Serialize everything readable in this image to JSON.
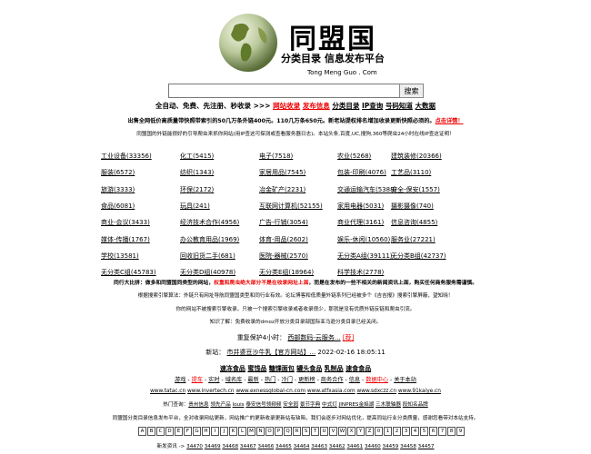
{
  "header": {
    "title": "同盟国",
    "subtitle": "分类目录  信息发布平台",
    "pinyin": "Tong Meng Guo . Com"
  },
  "search": {
    "value": "",
    "button": "搜索"
  },
  "nav": {
    "prefix": "全自动、免费、先注册、秒收录 >>>",
    "items": [
      {
        "label": "网站收录",
        "red": true
      },
      {
        "label": "发布信息",
        "red": true
      },
      {
        "label": "分类目录",
        "red": false
      },
      {
        "label": "IP查询",
        "red": false
      },
      {
        "label": "号码知道",
        "red": false
      },
      {
        "label": "大数据",
        "red": false
      }
    ]
  },
  "notice1": {
    "text": "出售全网低价高质量带快照带索引的50几万条外链400元。110几万条650元。新老站提权排名增加收录更新快照必须的。",
    "link": "点击详情！"
  },
  "notice2": "同盟国的外链能很好的引导爬虫来抓你网站(用IP查这可探测或查看服务器日志)。本站头条,百度,UC,搜狗,360等爬虫24小时在线IP查这证明！",
  "categories": [
    [
      "工业设备(33356)",
      "化工(5415)",
      "电子(7518)",
      "农业(5268)",
      "建筑装修(20366)"
    ],
    [
      "服装(6572)",
      "纺织(1343)",
      "家居用品(7545)",
      "包装-印刷(4076)",
      "工艺品(3110)"
    ],
    [
      "旅游(3333)",
      "环保(2172)",
      "冶金矿产(2231)",
      "交通运输汽车(5388)",
      "安全-保安(1557)"
    ],
    [
      "食品(6081)",
      "玩具(241)",
      "互联网计算机(52155)",
      "家用电器(5031)",
      "摄影摄像(740)"
    ],
    [
      "商业-会议(3433)",
      "经济技术合作(4956)",
      "广告-行销(3054)",
      "商业代理(3161)",
      "信息咨询(4855)"
    ],
    [
      "媒体-传播(1767)",
      "办公教育用品(1969)",
      "体育-用品(2602)",
      "娱乐-休闲(10560)",
      "服务业(27221)"
    ],
    [
      "学校(13581)",
      "回收旧货二手(681)",
      "医院-器械(2570)",
      "无分类A组(39111)",
      "无分类B组(42737)"
    ],
    [
      "无分类C组(45783)",
      "无分类D组(40978)",
      "无分类E组(18964)",
      "科学技术(2778)",
      ""
    ]
  ],
  "info": {
    "line1_a": "同行大比拼：做多和同盟国同类型的网站，",
    "line1_red": "权重和爬虫绝大部分不是在收录网址上面",
    "line1_b": "，而是在发布的一些不相关的新闻资讯上面，购买任何商务服务需谨慎。",
    "line2": "根据搜索引擎算法：外链只有网址导航同盟国类型和同行业有效。论坛博客和低质量外链系列已经被多个《吉吉报》搜索引擎屏蔽，望知晓！",
    "line3": "你的网站不被搜索引擎收录，只被一个搜索引擎收录或者收录很少，那就是没有优质外链反链和爬虫引流。",
    "line4": "知识了解：免费收录的dmoz开放分类目录部国际亚马逊分类目录已经关闭。"
  },
  "hot": {
    "label": "重复保护4小时：",
    "link": "西部数码-云服务...",
    "badge": "[荐]"
  },
  "newest": {
    "label": "新站：",
    "link": "市井婆豆沙牛乳【官方网站】...",
    "date": "2022-02-16 18:05:11"
  },
  "links_main": [
    "速冻食品",
    "蜜饯品",
    "糖馃面包",
    "罐头食品",
    "乳制品",
    "速食食品"
  ],
  "links_sub": [
    {
      "label": "游戏",
      "red": false
    },
    {
      "label": "提车",
      "red": true
    },
    {
      "label": "实时",
      "red": false
    },
    {
      "label": "域名库",
      "red": false
    },
    {
      "label": "最新",
      "red": false
    },
    {
      "label": "热门",
      "red": false
    },
    {
      "label": "冷门",
      "red": false
    },
    {
      "label": "更新榜",
      "red": false
    },
    {
      "label": "商务合作",
      "red": false
    },
    {
      "label": "信息",
      "red": false
    },
    {
      "label": "数据中心",
      "red": true
    },
    {
      "label": "关于本站",
      "red": false
    }
  ],
  "friend_sites": [
    "www.tatac.cn",
    "www.invertech.cn",
    "www.exnessglobal-cn.com",
    "www.atfxasia.com",
    "www.sdxczz.cn",
    "www.91kaiye.cn"
  ],
  "hot_search": {
    "label": "热门查询：",
    "items": [
      "贵州信息",
      "领先产品",
      "louis",
      "泰安信号领频频",
      "安全园",
      "景节字典",
      "中式灯",
      "JINPRES金焰湖",
      "三木联轴器",
      "段知名品牌"
    ]
  },
  "desc": "同盟国分类目录信息发布平台，全对收录网站更新，网站推广的更新收录更新站有缺陷，我们会逐步对网站优化，提高同站行业分类质量，感谢您看带对本站支持。",
  "alphabet": [
    "A",
    "B",
    "C",
    "D",
    "E",
    "F",
    "G",
    "H",
    "I",
    "J",
    "K",
    "L",
    "M",
    "N",
    "O",
    "P",
    "Q",
    "R",
    "S",
    "T",
    "U",
    "V",
    "W",
    "X",
    "Y",
    "Z",
    "0",
    "1",
    "2",
    "3",
    "4",
    "5",
    "6",
    "7",
    "8",
    "9"
  ],
  "newposts": {
    "label": "新发资讯 ->",
    "ids": [
      "34470",
      "34469",
      "34468",
      "34467",
      "34466",
      "34465",
      "34464",
      "34463",
      "34462",
      "34461",
      "34460",
      "34459",
      "34458",
      "34457"
    ]
  },
  "colors": {
    "accent_red": "#ee0000"
  }
}
